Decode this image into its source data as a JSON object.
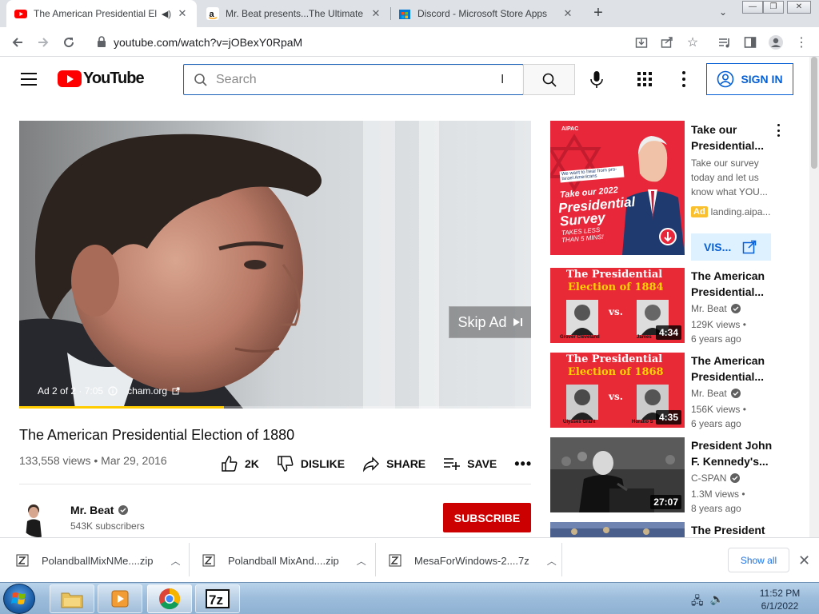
{
  "browser": {
    "tabs": [
      {
        "title": "The American Presidential El",
        "favicon": "youtube-icon",
        "active": true
      },
      {
        "title": "Mr. Beat presents...The Ultimate",
        "favicon": "amazon-icon",
        "active": false
      },
      {
        "title": "Discord - Microsoft Store Apps",
        "favicon": "microsoft-store-icon",
        "active": false
      }
    ],
    "url": "youtube.com/watch?v=jOBexY0RpaM"
  },
  "youtube": {
    "logo_text": "YouTube",
    "search_placeholder": "Search",
    "signin_label": "SIGN IN"
  },
  "player": {
    "skip_label": "Skip Ad",
    "ad_info": "Ad 2 of 2 · 7:05",
    "ad_domain": "cham.org",
    "ad_progress": 0.4
  },
  "video": {
    "title": "The American Presidential Election of 1880",
    "meta": "133,558 views • Mar 29, 2016",
    "likes": "2K",
    "dislike_label": "DISLIKE",
    "share_label": "SHARE",
    "save_label": "SAVE"
  },
  "channel": {
    "name": "Mr. Beat",
    "subscribers": "543K subscribers",
    "subscribe_label": "SUBSCRIBE"
  },
  "sidebar": {
    "ad": {
      "title": "Take our Presidential...",
      "description": "Take our survey today and let us know what YOU...",
      "badge": "Ad",
      "domain": "landing.aipa...",
      "visit_label": "VIS...",
      "thumb_brand": "AIPAC",
      "thumb_tagline": "We want to hear from pro-Israel Americans",
      "thumb_headline_1": "Take our 2022",
      "thumb_headline_2": "Presidential",
      "thumb_headline_3": "Survey",
      "thumb_sub_1": "TAKES LESS",
      "thumb_sub_2": "THAN 5 MINS!"
    },
    "recommendations": [
      {
        "title_1": "The American",
        "title_2": "Presidential...",
        "channel": "Mr. Beat",
        "verified": true,
        "views": "129K views •",
        "age": "6 years ago",
        "duration": "4:34",
        "thumb_line1": "The Presidential",
        "thumb_line2": "Election of 1884",
        "cand_left": "Grover Cleveland",
        "cand_right": "James"
      },
      {
        "title_1": "The American",
        "title_2": "Presidential...",
        "channel": "Mr. Beat",
        "verified": true,
        "views": "156K views •",
        "age": "6 years ago",
        "duration": "4:35",
        "thumb_line1": "The Presidential",
        "thumb_line2": "Election of 1868",
        "cand_left": "Ulysses Grant",
        "cand_right": "Horatio S"
      },
      {
        "title_1": "President John",
        "title_2": "F. Kennedy's...",
        "channel": "C-SPAN",
        "verified": true,
        "views": "1.3M views •",
        "age": "8 years ago",
        "duration": "27:07"
      },
      {
        "title_1": "The President"
      }
    ],
    "vs_label": "vs."
  },
  "downloads": {
    "items": [
      "PolandballMixNMe....zip",
      "Polandball MixAnd....zip",
      "MesaForWindows-2....7z"
    ],
    "show_all_label": "Show all"
  },
  "taskbar": {
    "time": "11:52 PM",
    "date": "6/1/2022"
  },
  "colors": {
    "youtube_red": "#ff0000",
    "link_blue": "#065fd4",
    "subscribe_red": "#cc0000",
    "ad_progress_yellow": "#ffcc00"
  }
}
